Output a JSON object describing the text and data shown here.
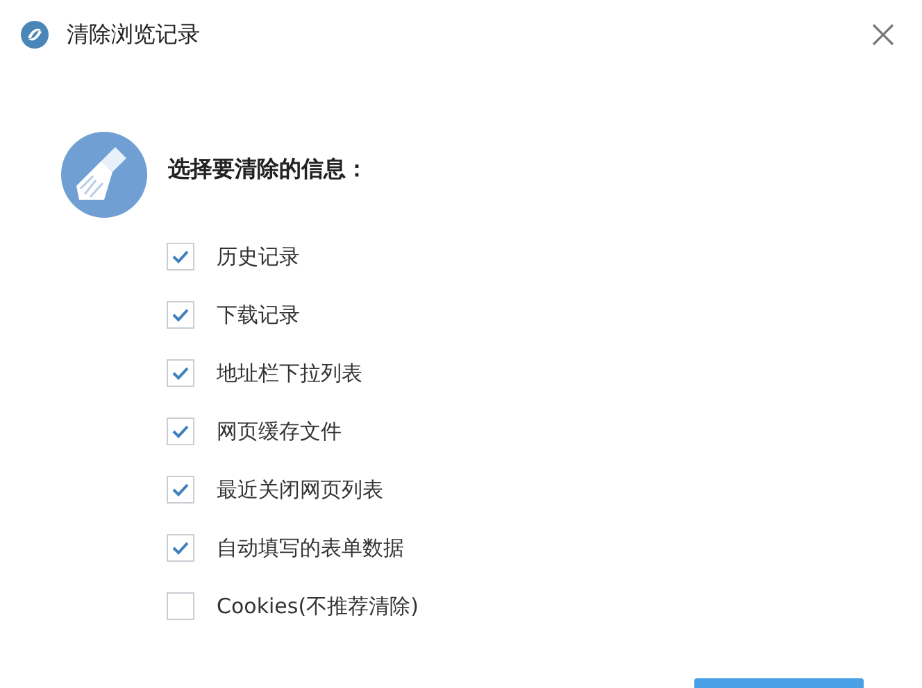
{
  "window": {
    "title": "清除浏览记录"
  },
  "heading": "选择要清除的信息：",
  "options": [
    {
      "label": "历史记录",
      "checked": true
    },
    {
      "label": "下载记录",
      "checked": true
    },
    {
      "label": "地址栏下拉列表",
      "checked": true
    },
    {
      "label": "网页缓存文件",
      "checked": true
    },
    {
      "label": "最近关闭网页列表",
      "checked": true
    },
    {
      "label": "自动填写的表单数据",
      "checked": true
    },
    {
      "label": "Cookies(不推荐清除)",
      "checked": false
    }
  ]
}
